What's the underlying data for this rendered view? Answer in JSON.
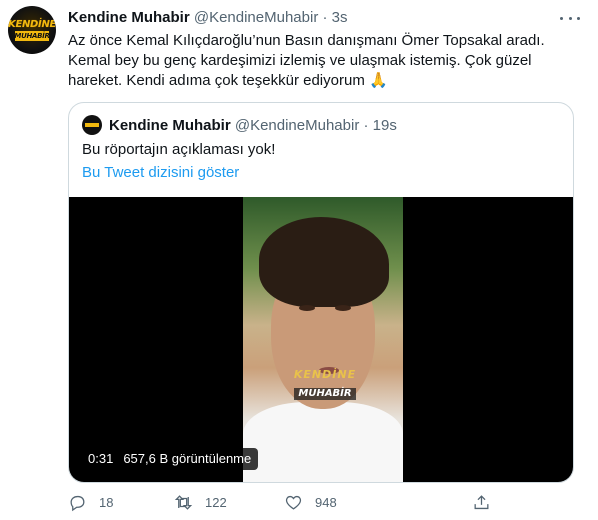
{
  "tweet": {
    "author_name": "Kendine Muhabir",
    "handle": "@KendineMuhabir",
    "separator": "·",
    "time": "3s",
    "text": "Az önce Kemal Kılıçdaroğlu’nun Basın danışmanı Ömer Topsakal aradı. Kemal bey bu genç kardeşimizi izlemiş ve ulaşmak istemiş. Çok güzel hareket. Kendi adıma çok teşekkür ediyorum 🙏",
    "avatar_text_top": "KENDİNE",
    "avatar_text_bottom": "MUHABİR"
  },
  "quote": {
    "author_name": "Kendine Muhabir",
    "handle": "@KendineMuhabir",
    "separator": "·",
    "time": "19s",
    "text": "Bu röportajın açıklaması yok!",
    "thread_link": "Bu Tweet dizisini göster",
    "video": {
      "duration": "0:31",
      "views": "657,6 B görüntülenme",
      "watermark_top": "KENDİNE",
      "watermark_bottom": "MUHABİR"
    }
  },
  "actions": {
    "reply_count": "18",
    "retweet_count": "122",
    "like_count": "948"
  },
  "icons": {
    "more": "more-icon",
    "reply": "reply-icon",
    "retweet": "retweet-icon",
    "like": "heart-icon",
    "share": "share-icon"
  },
  "colors": {
    "link": "#1d9bf0",
    "secondary_text": "#536471",
    "brand_yellow": "#f2b90f"
  }
}
